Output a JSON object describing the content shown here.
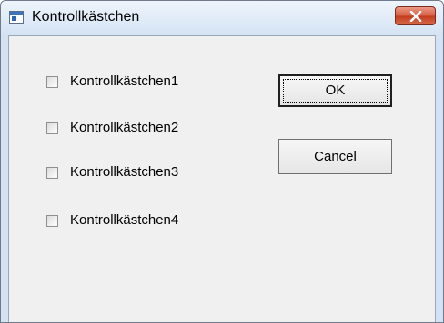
{
  "window": {
    "title": "Kontrollkästchen",
    "icon": "application-window-icon",
    "close_icon": "close-icon"
  },
  "checkboxes": [
    {
      "label": "Kontrollkästchen1",
      "checked": false
    },
    {
      "label": "Kontrollkästchen2",
      "checked": false
    },
    {
      "label": "Kontrollkästchen3",
      "checked": false
    },
    {
      "label": "Kontrollkästchen4",
      "checked": false
    }
  ],
  "buttons": {
    "ok_label": "OK",
    "cancel_label": "Cancel"
  },
  "colors": {
    "close_button": "#d55a3f",
    "dialog_background": "#f0f0f0",
    "title_bar": "#dbe8f6"
  }
}
